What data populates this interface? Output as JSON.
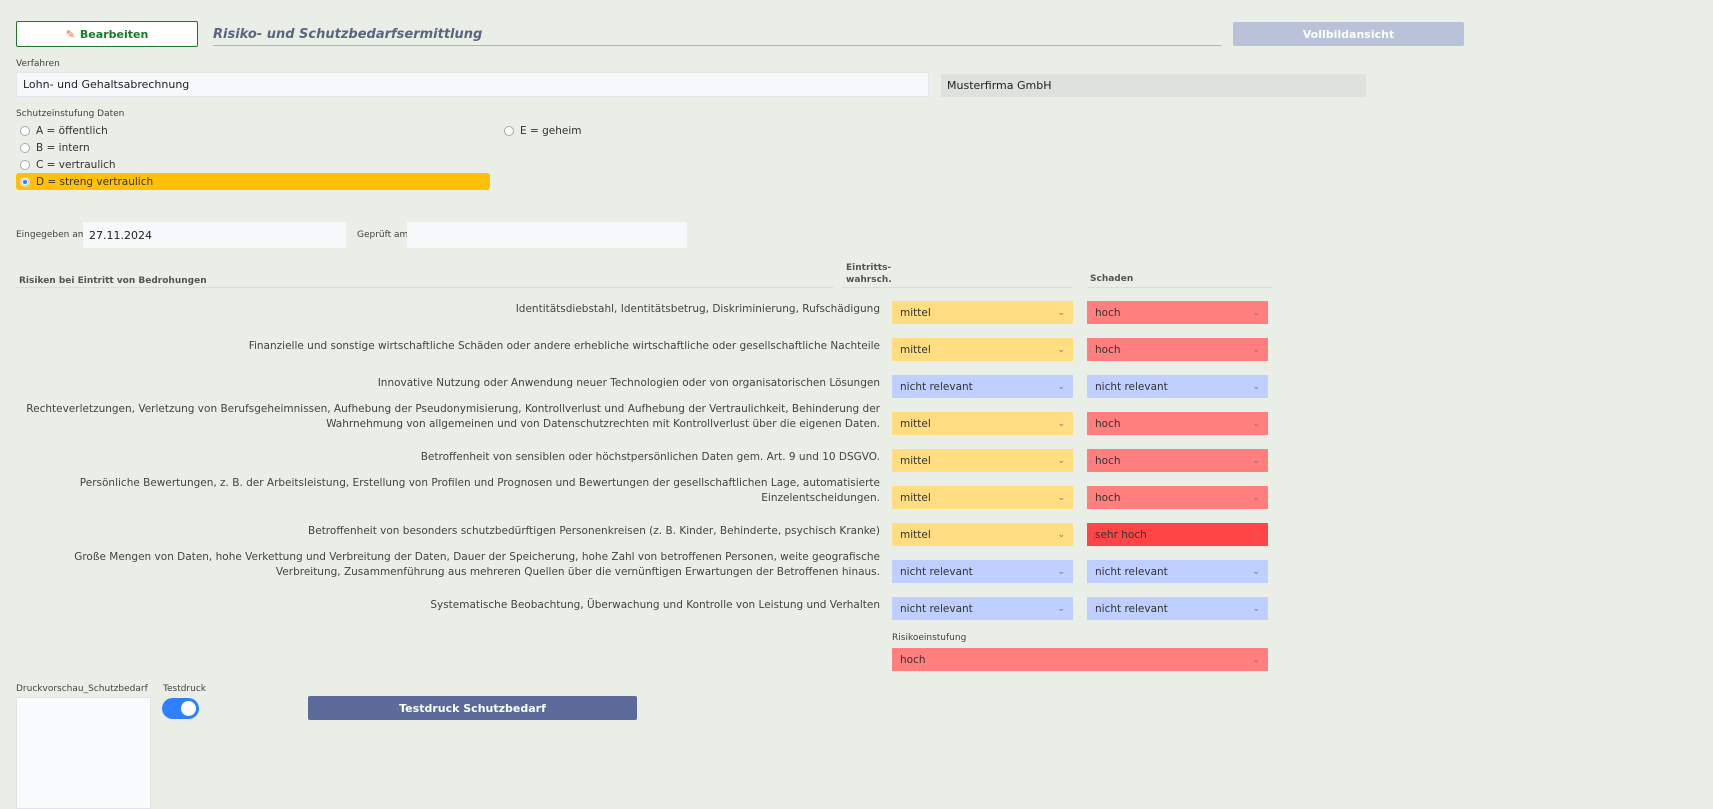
{
  "toolbar": {
    "edit_label": "Bearbeiten",
    "title": "Risiko- und Schutzbedarfsermittlung",
    "fullscreen_label": "Vollbildansicht"
  },
  "verfahren": {
    "label": "Verfahren",
    "value": "Lohn- und Gehaltsabrechnung",
    "company": "Musterfirma GmbH"
  },
  "schutz": {
    "label": "Schutzeinstufung Daten",
    "options": [
      "A = öffentlich",
      "B = intern",
      "C = vertraulich",
      "D = streng vertraulich",
      "E = geheim"
    ],
    "selected": "D = streng vertraulich"
  },
  "dates": {
    "entered_label": "Eingegeben am:",
    "entered_value": "27.11.2024",
    "checked_label": "Geprüft am:",
    "checked_value": ""
  },
  "table": {
    "col_risk": "Risiken bei Eintritt von Bedrohungen",
    "col_prob_1": "Eintritts-",
    "col_prob_2": "wahrsch.",
    "col_damage": "Schaden",
    "rows": [
      {
        "text": "Identitätsdiebstahl, Identitätsbetrug, Diskriminierung, Rufschädigung",
        "prob": "mittel",
        "damage": "hoch"
      },
      {
        "text": "Finanzielle und sonstige wirtschaftliche Schäden oder andere erhebliche wirtschaftliche oder gesellschaftliche Nachteile",
        "prob": "mittel",
        "damage": "hoch"
      },
      {
        "text": "Innovative Nutzung oder Anwendung neuer Technologien oder von organisatorischen Lösungen",
        "prob": "nicht relevant",
        "damage": "nicht relevant"
      },
      {
        "text": "Rechteverletzungen, Verletzung von Berufsgeheimnissen, Aufhebung der Pseudonymisierung, Kontrollverlust und Aufhebung der Vertraulichkeit, Behinderung der Wahrnehmung von allgemeinen und von Datenschutzrechten mit Kontrollverlust über die eigenen Daten.",
        "prob": "mittel",
        "damage": "hoch"
      },
      {
        "text": "Betroffenheit von sensiblen oder höchstpersönlichen Daten gem. Art. 9 und 10 DSGVO.",
        "prob": "mittel",
        "damage": "hoch"
      },
      {
        "text": "Persönliche Bewertungen, z. B. der Arbeitsleistung, Erstellung von Profilen und Prognosen und Bewertungen der gesellschaftlichen Lage, automatisierte Einzelentscheidungen.",
        "prob": "mittel",
        "damage": "hoch"
      },
      {
        "text": "Betroffenheit von besonders schutzbedürftigen Personenkreisen (z. B. Kinder, Behinderte, psychisch Kranke)",
        "prob": "mittel",
        "damage": "sehr hoch"
      },
      {
        "text": "Große Mengen von Daten, hohe Verkettung und Verbreitung der Daten, Dauer der Speicherung, hohe Zahl von betroffenen Personen, weite geografische Verbreitung, Zusammenführung aus mehreren Quellen über die vernünftigen Erwartungen der Betroffenen hinaus.",
        "prob": "nicht relevant",
        "damage": "nicht relevant"
      },
      {
        "text": "Systematische Beobachtung, Überwachung und Kontrolle von Leistung und Verhalten",
        "prob": "nicht relevant",
        "damage": "nicht relevant"
      }
    ]
  },
  "risk_rating": {
    "label": "Risikoeinstufung",
    "value": "hoch"
  },
  "print": {
    "preview_label": "Druckvorschau_Schutzbedarf",
    "testdruck_label": "Testdruck",
    "testdruck_on": true,
    "button_label": "Testdruck Schutzbedarf"
  },
  "colors": {
    "mittel": "#ffdd80",
    "hoch": "#ff7f7f",
    "sehr hoch": "#ff4545",
    "nicht relevant": "#bfcfff"
  }
}
